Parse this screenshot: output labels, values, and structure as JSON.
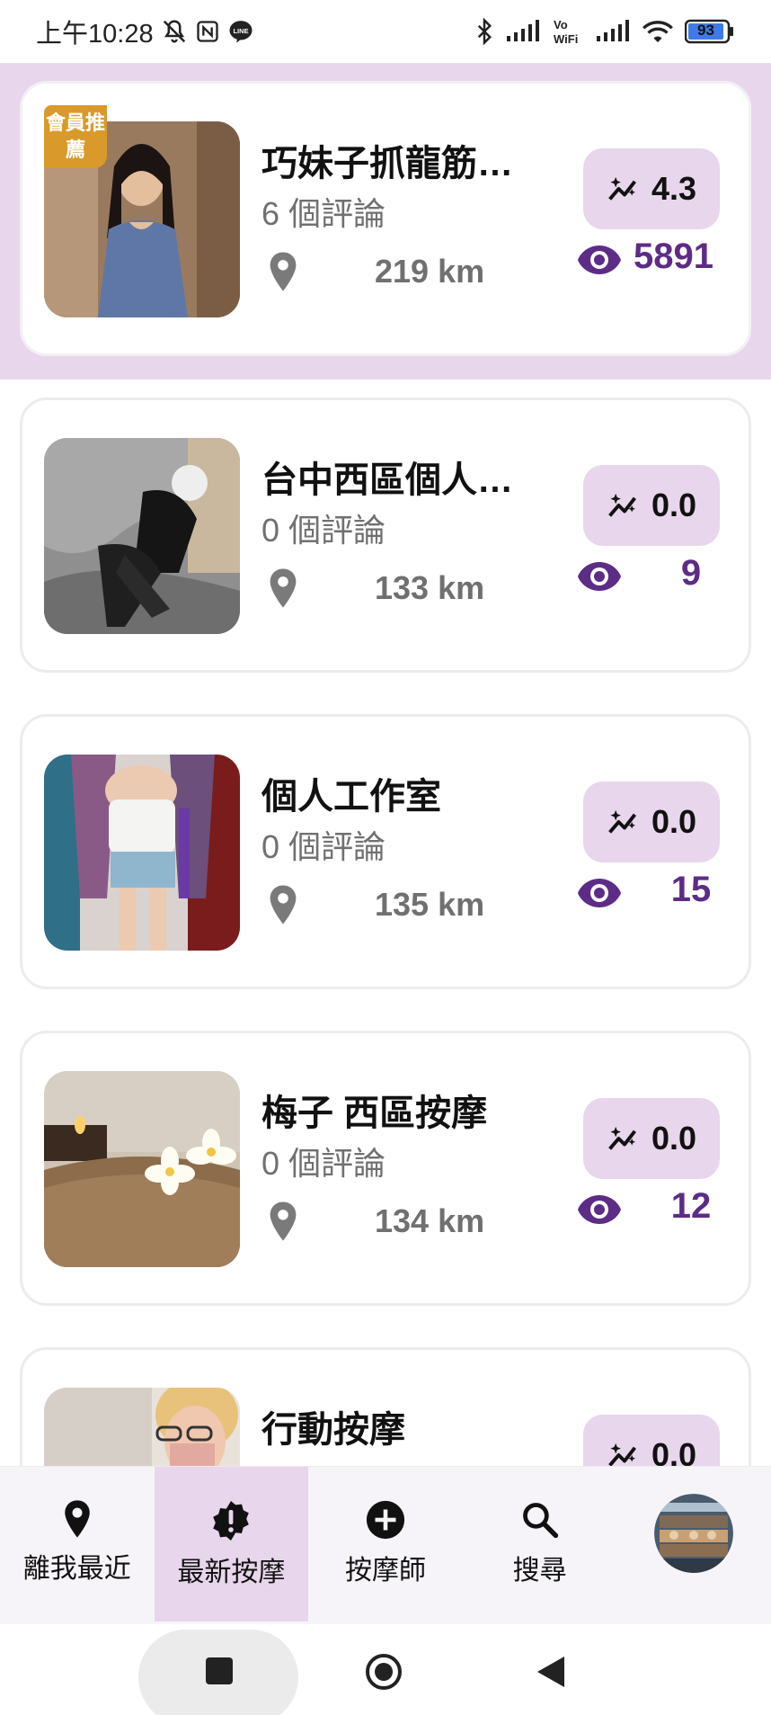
{
  "status_bar": {
    "time": "上午10:28",
    "battery": "93"
  },
  "listings": [
    {
      "name": "巧妹子抓龍筋…",
      "reviews": "6 個評論",
      "distance": "219 km",
      "rating": "4.3",
      "views": "5891",
      "badge": "會員推薦",
      "highlight": true
    },
    {
      "name": "台中西區個人…",
      "reviews": "0 個評論",
      "distance": "133 km",
      "rating": "0.0",
      "views": "9"
    },
    {
      "name": "個人工作室",
      "reviews": "0 個評論",
      "distance": "135 km",
      "rating": "0.0",
      "views": "15"
    },
    {
      "name": "梅子 西區按摩",
      "reviews": "0 個評論",
      "distance": "134 km",
      "rating": "0.0",
      "views": "12"
    },
    {
      "name": "行動按摩",
      "rating": "0.0"
    }
  ],
  "bottom_nav": {
    "items": [
      {
        "label": "離我最近",
        "icon": "location-pin-icon"
      },
      {
        "label": "最新按摩",
        "icon": "alert-badge-icon",
        "active": true
      },
      {
        "label": "按摩師",
        "icon": "add-circle-icon"
      },
      {
        "label": "搜尋",
        "icon": "search-icon"
      },
      {
        "label": "",
        "icon": "profile-avatar"
      }
    ]
  },
  "colors": {
    "accent": "#5c2c86",
    "highlight": "#e8d6ec",
    "badge": "#d99a2b",
    "muted_text": "#707070"
  }
}
